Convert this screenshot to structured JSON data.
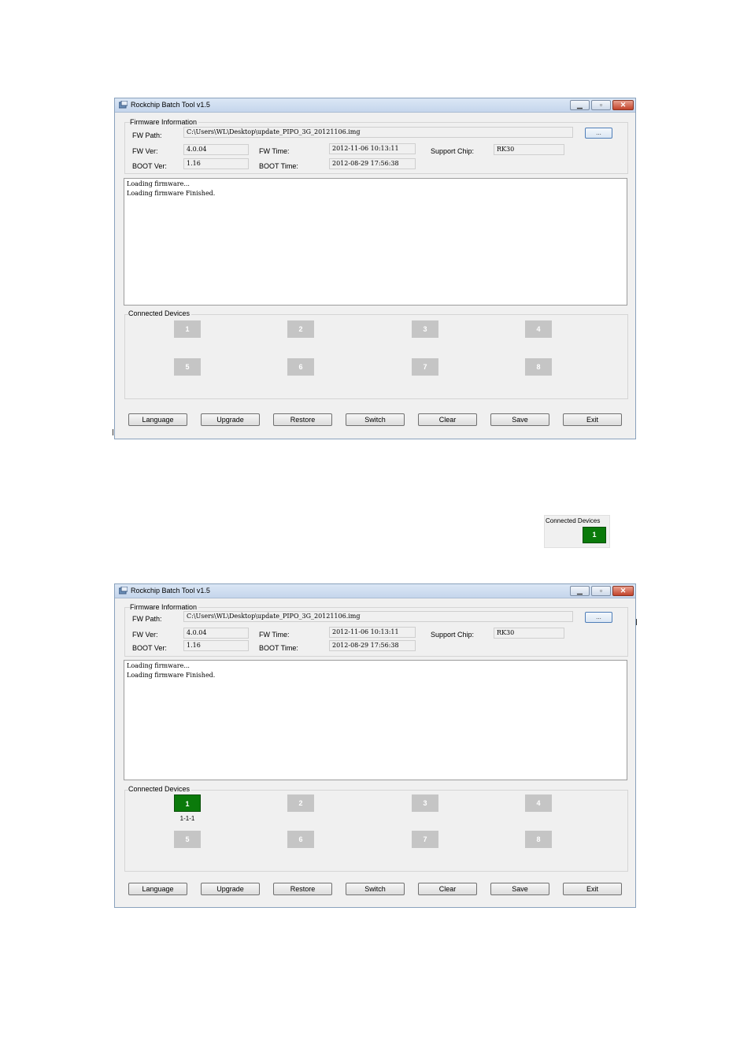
{
  "window": {
    "title": "Rockchip Batch Tool v1.5",
    "min_glyph": "▁",
    "max_glyph": "▫",
    "close_glyph": "✕"
  },
  "firmware": {
    "group_title": "Firmware Information",
    "fw_path_label": "FW Path:",
    "fw_path": "C:\\Users\\WL\\Desktop\\update_PIPO_3G_20121106.img",
    "browse_label": "...",
    "fw_ver_label": "FW Ver:",
    "fw_ver": "4.0.04",
    "fw_time_label": "FW Time:",
    "fw_time": "2012-11-06 10:13:11",
    "support_chip_label": "Support Chip:",
    "support_chip": "RK30",
    "boot_ver_label": "BOOT Ver:",
    "boot_ver": "1.16",
    "boot_time_label": "BOOT Time:",
    "boot_time": "2012-08-29 17:56:38"
  },
  "log": {
    "lines": [
      "Loading firmware...",
      "Loading firmware Finished."
    ]
  },
  "devices": {
    "group_title": "Connected Devices",
    "slots": [
      "1",
      "2",
      "3",
      "4",
      "5",
      "6",
      "7",
      "8"
    ],
    "connected_slot": "1",
    "connected_port": "1-1-1"
  },
  "buttons": {
    "language": "Language",
    "upgrade": "Upgrade",
    "restore": "Restore",
    "switch": "Switch",
    "clear": "Clear",
    "save": "Save",
    "exit": "Exit"
  },
  "colors": {
    "connected": "#0b7a0b",
    "idle": "#c5c5c5"
  },
  "icons": {
    "app": "app-icon",
    "minimize": "minimize-icon",
    "maximize": "maximize-icon",
    "close": "close-icon"
  }
}
